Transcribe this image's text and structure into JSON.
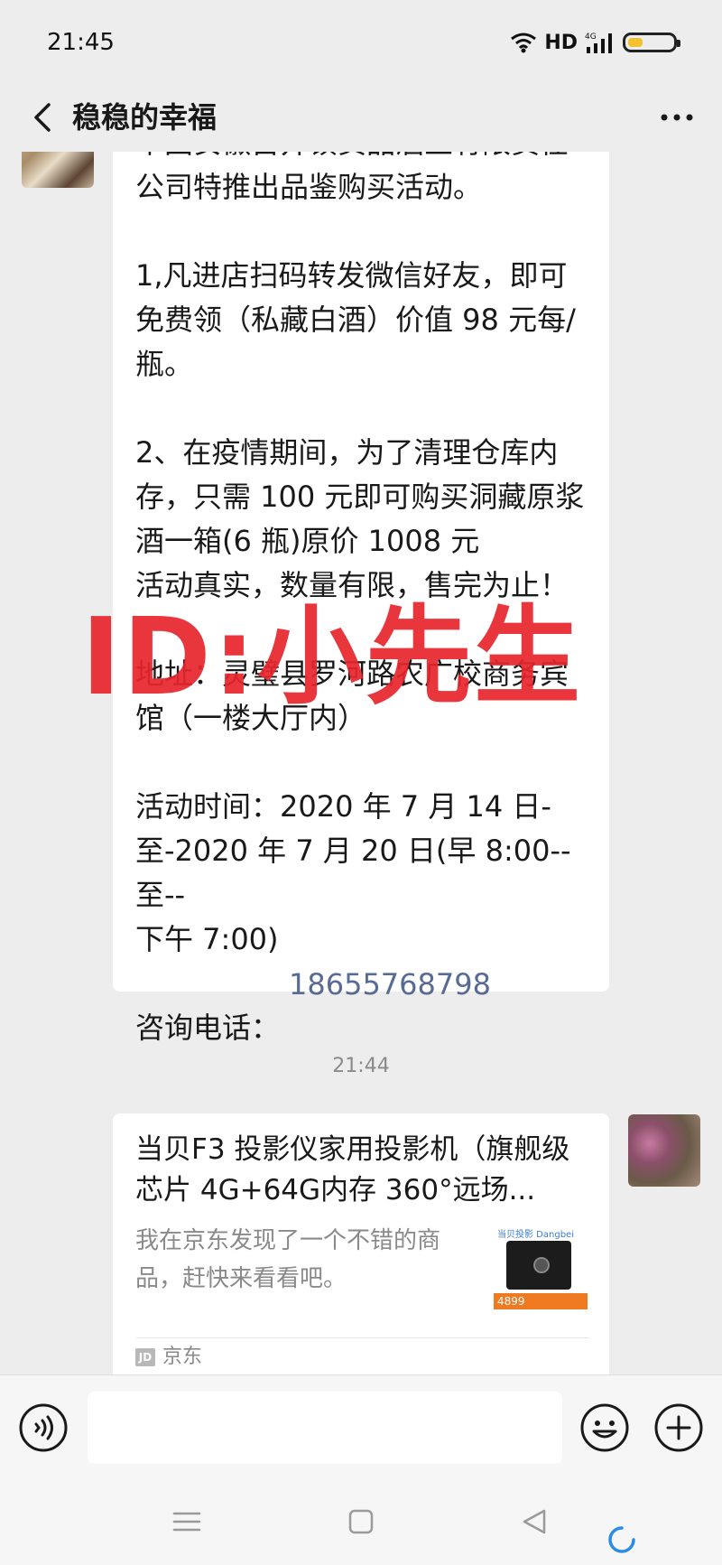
{
  "status_bar": {
    "time": "21:45",
    "hd": "HD",
    "network": "4G"
  },
  "header": {
    "title": "稳稳的幸福"
  },
  "message1": {
    "text": "中国安徽古井镇贡品酒业有限责任\n公司特推出品鉴购买活动。\n\n1,凡进店扫码转发微信好友，即可\n免费领（私藏白酒）价值 98 元每/\n瓶。\n\n2、在疫情期间，为了清理仓库内\n存，只需 100 元即可购买洞藏原浆\n酒一箱(6 瓶)原价 1008 元\n活动真实，数量有限，售完为止！\n\n地址：灵璧县罗河路农广校商务宾\n馆（一楼大厅内）\n\n活动时间：2020 年 7 月 14 日-\n至-2020 年 7 月 20 日(早 8:00--至--\n下午 7:00)\n\n咨询电话：",
    "phone": "18655768798"
  },
  "watermark": "ID:小先生",
  "timestamp": "21:44",
  "message2": {
    "card_title": "当贝F3 投影仪家用投影机（旗舰级芯片 4G+64G内存 360°远场...",
    "card_desc": "我在京东发现了一个不错的商品，赶快来看看吧。",
    "thumb_brand": "当贝投影 Dangbei",
    "thumb_price": "4899",
    "source_icon": "JD",
    "source": "京东"
  },
  "input": {
    "placeholder": ""
  },
  "icons": {
    "back": "back-arrow-icon",
    "more": "more-dots-icon",
    "voice": "voice-icon",
    "emoji": "emoji-icon",
    "plus": "plus-icon",
    "nav_menu": "menu-icon",
    "nav_home": "home-icon",
    "nav_back": "triangle-back-icon"
  },
  "colors": {
    "background": "#ededed",
    "link": "#576b95",
    "watermark": "#e8262d",
    "bubble": "#ffffff"
  }
}
